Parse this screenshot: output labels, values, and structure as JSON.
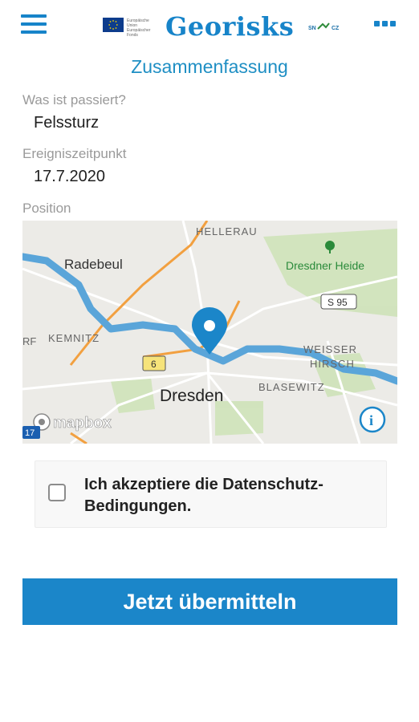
{
  "header": {
    "app_title": "Georisks",
    "eu_caption": "Europäische Union Europäischer Fonds",
    "partner_caption": "SN CZ"
  },
  "summary": {
    "title": "Zusammenfassung",
    "what_label": "Was ist passiert?",
    "what_value": "Felssturz",
    "time_label": "Ereigniszeitpunkt",
    "time_value": "17.7.2020",
    "position_label": "Position"
  },
  "map": {
    "labels": {
      "hellerau": "HELLERAU",
      "radebeul": "Radebeul",
      "dresdner_heide": "Dresdner Heide",
      "s95": "S 95",
      "kemnitz": "KEMNITZ",
      "rf": "RF",
      "weisser": "WEISSER",
      "hirsch": "HIRSCH",
      "road6": "6",
      "dresden": "Dresden",
      "blasewitz": "BLASEWITZ",
      "mapbox": "mapbox",
      "road17": "17"
    },
    "colors": {
      "water": "#5aa5d9",
      "road_orange": "#f2a040",
      "marker": "#1b86c9"
    }
  },
  "consent": {
    "text": "Ich akzeptiere die Datenschutz-Bedingungen.",
    "checked": false
  },
  "submit": {
    "label": "Jetzt übermitteln"
  }
}
